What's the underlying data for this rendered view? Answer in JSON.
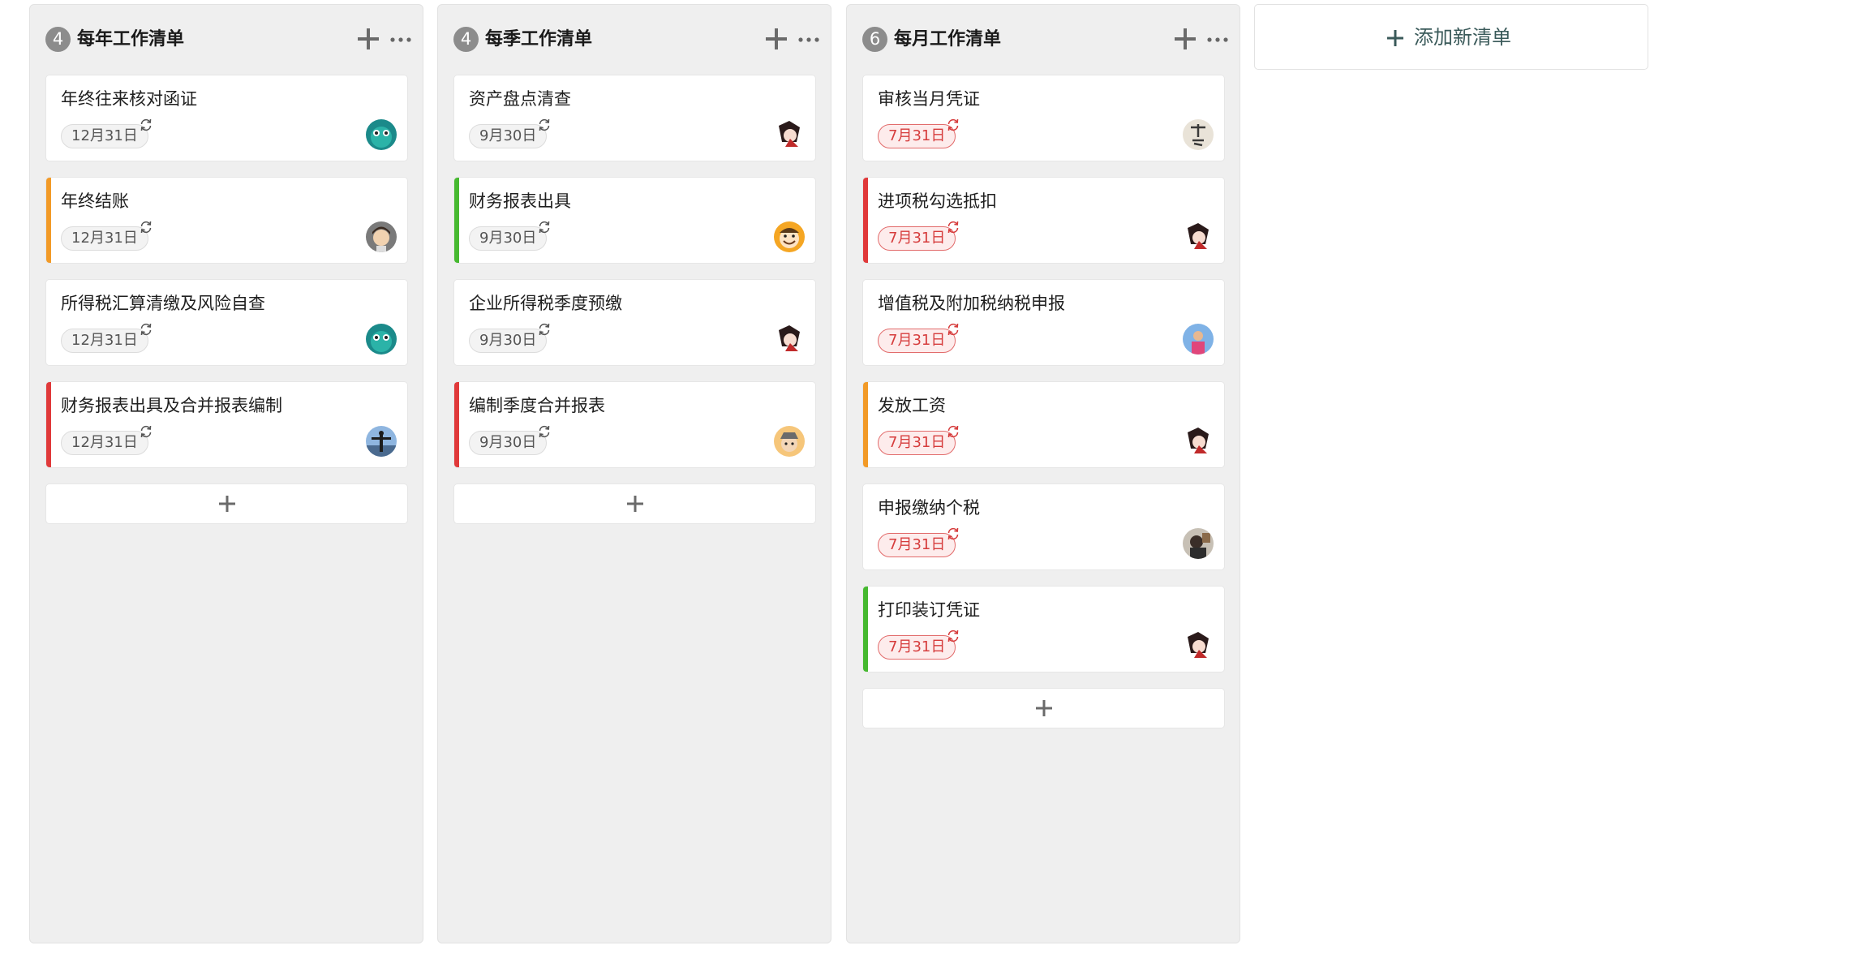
{
  "colors": {
    "red": "#e0393a",
    "orange": "#f29a27",
    "green": "#46b930",
    "overdue_text": "#d63c3c",
    "column_bg": "#efefef"
  },
  "columns": [
    {
      "count": "4",
      "title": "每年工作清单",
      "add_icon": "plus-icon",
      "more_icon": "more-icon",
      "cards": [
        {
          "title": "年终往来核对函证",
          "date": "12月31日",
          "overdue": false,
          "priority": "none",
          "avatar": "cartoon-teal"
        },
        {
          "title": "年终结账",
          "date": "12月31日",
          "overdue": false,
          "priority": "orange",
          "avatar": "cartoon-boy"
        },
        {
          "title": "所得税汇算清缴及风险自查",
          "date": "12月31日",
          "overdue": false,
          "priority": "none",
          "avatar": "cartoon-teal"
        },
        {
          "title": "财务报表出具及合并报表编制",
          "date": "12月31日",
          "overdue": false,
          "priority": "red",
          "avatar": "photo-sky"
        }
      ]
    },
    {
      "count": "4",
      "title": "每季工作清单",
      "add_icon": "plus-icon",
      "more_icon": "more-icon",
      "cards": [
        {
          "title": "资产盘点清查",
          "date": "9月30日",
          "overdue": false,
          "priority": "none",
          "avatar": "anime-red"
        },
        {
          "title": "财务报表出具",
          "date": "9月30日",
          "overdue": false,
          "priority": "green",
          "avatar": "cartoon-smile"
        },
        {
          "title": "企业所得税季度预缴",
          "date": "9月30日",
          "overdue": false,
          "priority": "none",
          "avatar": "anime-red"
        },
        {
          "title": "编制季度合并报表",
          "date": "9月30日",
          "overdue": false,
          "priority": "red",
          "avatar": "cartoon-hat"
        }
      ]
    },
    {
      "count": "6",
      "title": "每月工作清单",
      "add_icon": "plus-icon",
      "more_icon": "more-icon",
      "cards": [
        {
          "title": "审核当月凭证",
          "date": "7月31日",
          "overdue": true,
          "priority": "none",
          "avatar": "calligraphy"
        },
        {
          "title": "进项税勾选抵扣",
          "date": "7月31日",
          "overdue": true,
          "priority": "red",
          "avatar": "anime-red"
        },
        {
          "title": "增值税及附加税纳税申报",
          "date": "7月31日",
          "overdue": true,
          "priority": "none",
          "avatar": "photo-person"
        },
        {
          "title": "发放工资",
          "date": "7月31日",
          "overdue": true,
          "priority": "orange",
          "avatar": "anime-red"
        },
        {
          "title": "申报缴纳个税",
          "date": "7月31日",
          "overdue": true,
          "priority": "none",
          "avatar": "photo-dark"
        },
        {
          "title": "打印装订凭证",
          "date": "7月31日",
          "overdue": true,
          "priority": "green",
          "avatar": "anime-red"
        }
      ]
    }
  ],
  "add_list": {
    "label": "添加新清单",
    "icon": "plus-icon"
  }
}
